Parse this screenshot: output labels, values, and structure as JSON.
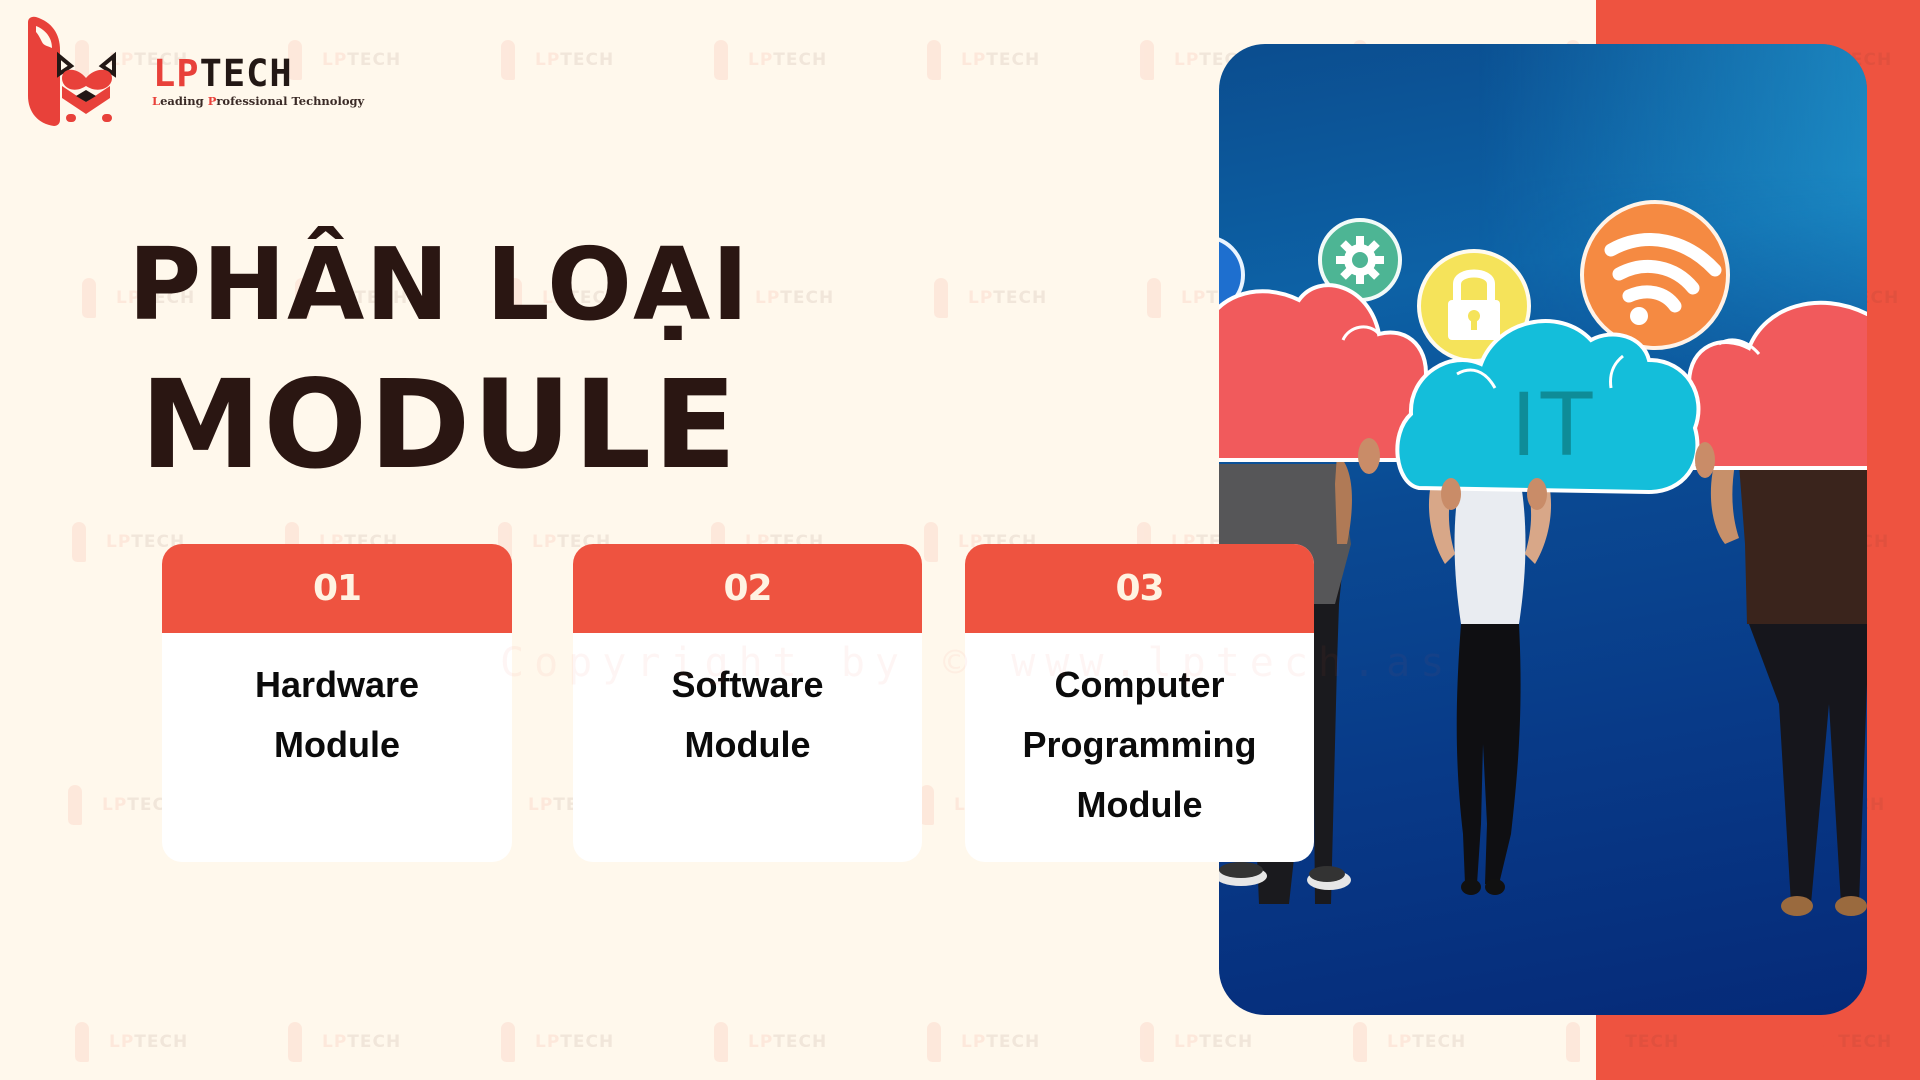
{
  "brand": {
    "logo_word_red": "LP",
    "logo_word_dark": "TECH",
    "tagline_parts": [
      {
        "text": "L",
        "accent": true
      },
      {
        "text": "eading ",
        "accent": false
      },
      {
        "text": "P",
        "accent": true
      },
      {
        "text": "rofessional Technology",
        "accent": false
      }
    ],
    "watermark_red": "LP",
    "watermark_dark": "TECH"
  },
  "title": {
    "line1": "PHÂN LOẠI",
    "line2": "MODULE"
  },
  "cards": [
    {
      "number": "01",
      "lines": [
        "Hardware",
        "Module"
      ]
    },
    {
      "number": "02",
      "lines": [
        "Software",
        "Module"
      ]
    },
    {
      "number": "03",
      "lines": [
        "Computer",
        "Programming",
        "Module"
      ]
    }
  ],
  "copyright_watermark": "Copyright by © www.lptech.as",
  "photo": {
    "sign_text": "IT",
    "icons": [
      "gear-icon",
      "lock-icon",
      "wifi-icon"
    ]
  },
  "colors": {
    "accent_red": "#EE5340",
    "background": "#FFF8EC",
    "title_text": "#2A1612",
    "card_number": "#FFF3E2"
  }
}
